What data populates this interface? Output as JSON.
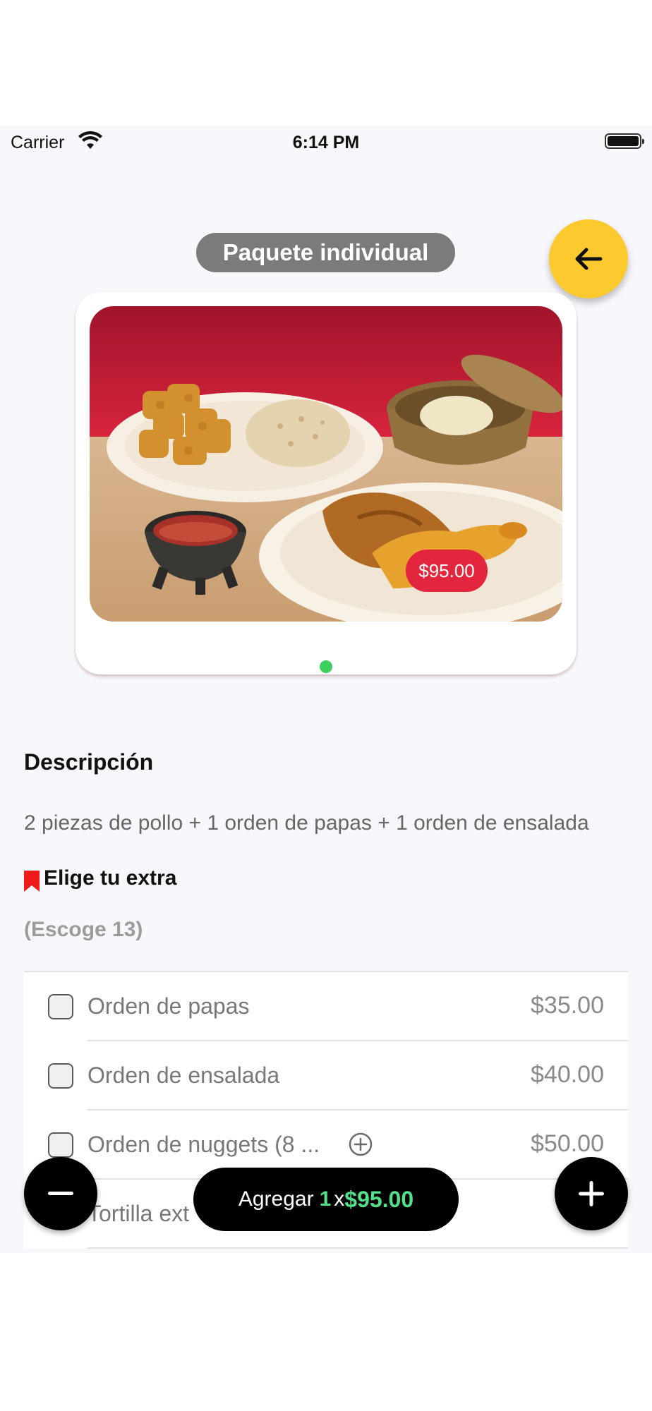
{
  "status_bar": {
    "carrier": "Carrier",
    "time": "6:14 PM"
  },
  "header": {
    "title": "Paquete individual",
    "back_icon": "arrow-left-icon",
    "back_color": "#fcc92f"
  },
  "product": {
    "price_badge": "$95.00",
    "image_description": "fried-chicken-combo-plate",
    "carousel_active_color": "#3ccf5c"
  },
  "description": {
    "heading": "Descripción",
    "text": "2 piezas de pollo + 1 orden de papas + 1 orden de ensalada"
  },
  "extras": {
    "heading": "Elige tu extra",
    "count_label": "(Escoge 13)",
    "items": [
      {
        "label": "Orden de papas",
        "price": "$35.00",
        "checked": false
      },
      {
        "label": "Orden de ensalada",
        "price": "$40.00",
        "checked": false
      },
      {
        "label": "Orden de nuggets (8 ...",
        "price": "$50.00",
        "checked": false,
        "has_info": true
      },
      {
        "label": "Tortilla ext",
        "price": "$/",
        "checked": false
      }
    ]
  },
  "footer": {
    "add_label": "Agregar",
    "quantity": "1",
    "times": "x",
    "total": "$95.00",
    "accent_color": "#54e08a"
  }
}
